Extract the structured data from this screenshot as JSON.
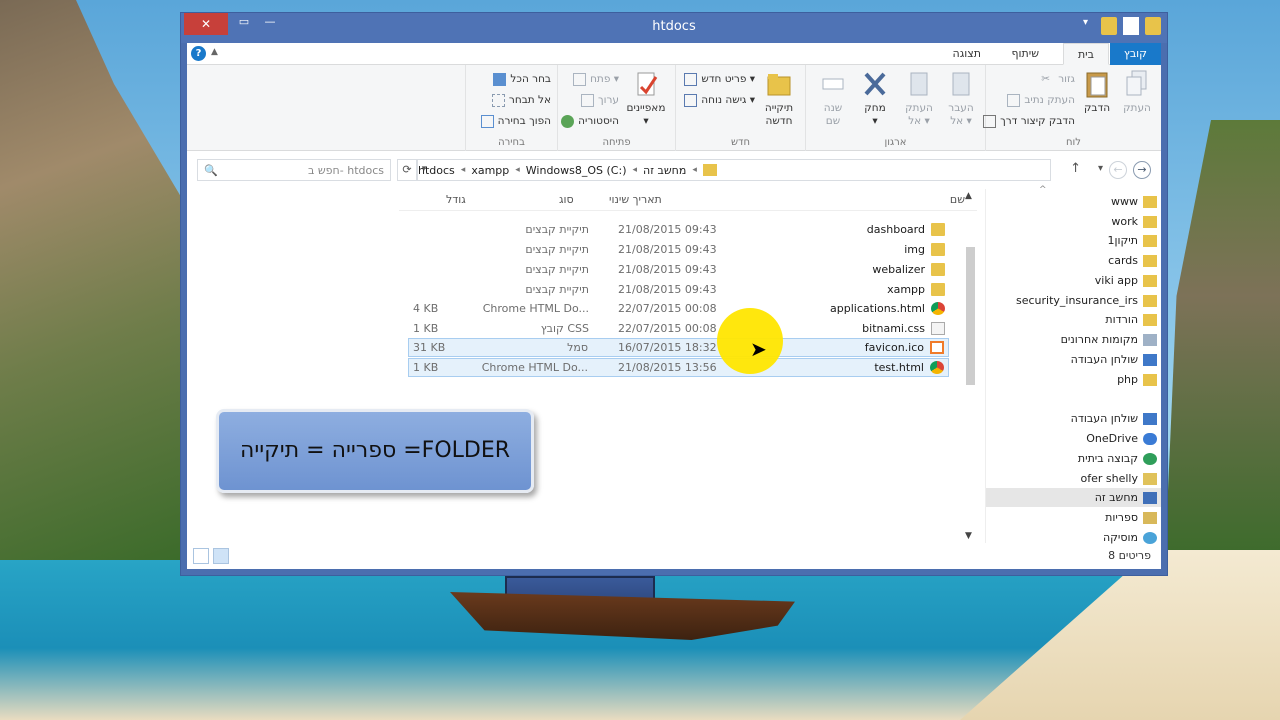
{
  "window": {
    "title": "htdocs"
  },
  "ribbon_tabs": [
    "קובץ",
    "בית",
    "שיתוף",
    "תצוגה"
  ],
  "ribbon": {
    "clipboard": {
      "copy": "העתק",
      "paste": "הדבק",
      "cut": "גזור",
      "copy_path": "העתק נתיב",
      "paste_shortcut": "הדבק קיצור דרך",
      "label": "לוח"
    },
    "organize": {
      "move_to": "העבר\nאל ▾",
      "copy_to": "העתק\nאל ▾",
      "delete": "מחק\n▾",
      "rename": "שנה\nשם",
      "label": "ארגון"
    },
    "new": {
      "new_folder": "תיקייה\nחדשה",
      "new_item": "פריט חדש ▾",
      "easy_access": "גישה נוחה ▾",
      "label": "חדש"
    },
    "open": {
      "properties": "מאפיינים\n▾",
      "open": "פתח ▾",
      "edit": "ערוך",
      "history": "היסטוריה",
      "label": "פתיחה"
    },
    "select": {
      "select_all": "בחר הכל",
      "select_none": "אל תבחר",
      "invert": "הפוך בחירה",
      "label": "בחירה"
    }
  },
  "address": {
    "segments": [
      "מחשב זה",
      "Windows8_OS (C:)",
      "xampp",
      "htdocs"
    ],
    "search_placeholder": "חפש ב- htdocs"
  },
  "columns": {
    "name": "שם",
    "date": "תאריך שינוי",
    "type": "סוג",
    "size": "גודל"
  },
  "files": [
    {
      "name": "dashboard",
      "date": "21/08/2015 09:43",
      "type": "תיקיית קבצים",
      "size": "",
      "icon": "folder-icon"
    },
    {
      "name": "img",
      "date": "21/08/2015 09:43",
      "type": "תיקיית קבצים",
      "size": "",
      "icon": "folder-icon"
    },
    {
      "name": "webalizer",
      "date": "21/08/2015 09:43",
      "type": "תיקיית קבצים",
      "size": "",
      "icon": "folder-icon"
    },
    {
      "name": "xampp",
      "date": "21/08/2015 09:43",
      "type": "תיקיית קבצים",
      "size": "",
      "icon": "folder-icon"
    },
    {
      "name": "applications.html",
      "date": "22/07/2015 00:08",
      "type": "Chrome HTML Do...",
      "size": "4 KB",
      "icon": "chrome-icon"
    },
    {
      "name": "bitnami.css",
      "date": "22/07/2015 00:08",
      "type": "קובץ CSS",
      "size": "1 KB",
      "icon": "css-file-icon"
    },
    {
      "name": "favicon.ico",
      "date": "16/07/2015 18:32",
      "type": "סמל",
      "size": "31 KB",
      "icon": "xampp-icon"
    },
    {
      "name": "test.html",
      "date": "21/08/2015 13:56",
      "type": "Chrome HTML Do...",
      "size": "1 KB",
      "icon": "chrome-icon"
    }
  ],
  "nav_pane": [
    {
      "label": "www",
      "icon": "folder"
    },
    {
      "label": "work",
      "icon": "folder"
    },
    {
      "label": "תיקון1",
      "icon": "folder"
    },
    {
      "label": "cards",
      "icon": "folder"
    },
    {
      "label": "viki app",
      "icon": "folder"
    },
    {
      "label": "security_insurance_irs",
      "icon": "folder"
    },
    {
      "label": "הורדות",
      "icon": "folder"
    },
    {
      "label": "מקומות אחרונים",
      "icon": "recent"
    },
    {
      "label": "שולחן העבודה",
      "icon": "desktop"
    },
    {
      "label": "php",
      "icon": "folder"
    },
    {
      "label": "שולחן העבודה",
      "icon": "desktop"
    },
    {
      "label": "OneDrive",
      "icon": "cloud"
    },
    {
      "label": "קבוצה ביתית",
      "icon": "home"
    },
    {
      "label": "ofer shelly",
      "icon": "user"
    },
    {
      "label": "מחשב זה",
      "icon": "pc"
    },
    {
      "label": "ספריות",
      "icon": "lib"
    },
    {
      "label": "מוסיקה",
      "icon": "music"
    }
  ],
  "status": {
    "item_count": "8 פריטים"
  },
  "callout": {
    "text": "ספרייה = תיקייה =FOLDER"
  }
}
